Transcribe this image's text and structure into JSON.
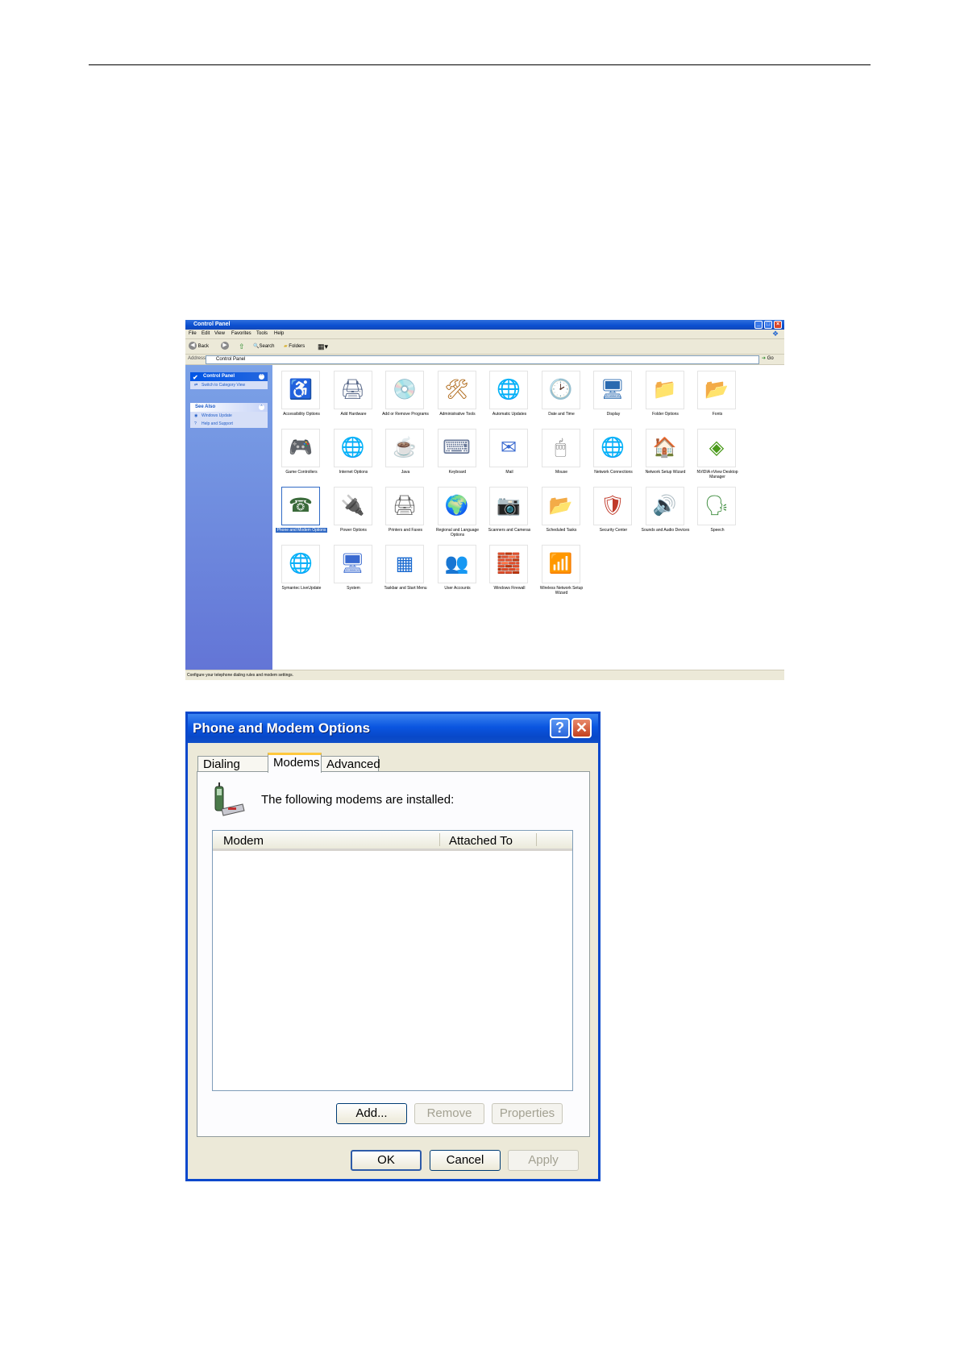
{
  "control_panel": {
    "title": "Control Panel",
    "menu": [
      "File",
      "Edit",
      "View",
      "Favorites",
      "Tools",
      "Help"
    ],
    "toolbar": {
      "back": "Back",
      "search": "Search",
      "folders": "Folders"
    },
    "address_label": "Address",
    "address_value": "Control Panel",
    "go_label": "Go",
    "side_panel": {
      "title": "Control Panel",
      "switch_link": "Switch to Category View",
      "see_also_title": "See Also",
      "see_also": [
        "Windows Update",
        "Help and Support"
      ]
    },
    "items": [
      {
        "label": "Accessibility Options",
        "icon": "accessibility-icon",
        "glyph": "♿",
        "color": "#2a9a2a"
      },
      {
        "label": "Add Hardware",
        "icon": "add-hardware-icon",
        "glyph": "🖨",
        "color": "#5a6a8a"
      },
      {
        "label": "Add or Remove Programs",
        "icon": "add-remove-programs-icon",
        "glyph": "💿",
        "color": "#3a6ad0"
      },
      {
        "label": "Administrative Tools",
        "icon": "administrative-tools-icon",
        "glyph": "🛠",
        "color": "#b06a1a"
      },
      {
        "label": "Automatic Updates",
        "icon": "automatic-updates-icon",
        "glyph": "🌐",
        "color": "#1a6ad0"
      },
      {
        "label": "Date and Time",
        "icon": "date-time-icon",
        "glyph": "🕑",
        "color": "#2a5ab0"
      },
      {
        "label": "Display",
        "icon": "display-icon",
        "glyph": "🖥",
        "color": "#2a6ab0"
      },
      {
        "label": "Folder Options",
        "icon": "folder-options-icon",
        "glyph": "📁",
        "color": "#d8b030"
      },
      {
        "label": "Fonts",
        "icon": "fonts-icon",
        "glyph": "📂",
        "color": "#d8b030"
      },
      {
        "label": "Game Controllers",
        "icon": "game-controllers-icon",
        "glyph": "🎮",
        "color": "#6a6ab0"
      },
      {
        "label": "Internet Options",
        "icon": "internet-options-icon",
        "glyph": "🌐",
        "color": "#1a6ad0"
      },
      {
        "label": "Java",
        "icon": "java-icon",
        "glyph": "☕",
        "color": "#c04a1a"
      },
      {
        "label": "Keyboard",
        "icon": "keyboard-icon",
        "glyph": "⌨",
        "color": "#6a7a9a"
      },
      {
        "label": "Mail",
        "icon": "mail-icon",
        "glyph": "✉",
        "color": "#3a6ad0"
      },
      {
        "label": "Mouse",
        "icon": "mouse-icon",
        "glyph": "🖱",
        "color": "#7a7a7a"
      },
      {
        "label": "Network Connections",
        "icon": "network-connections-icon",
        "glyph": "🌐",
        "color": "#1a8a3a"
      },
      {
        "label": "Network Setup Wizard",
        "icon": "network-setup-wizard-icon",
        "glyph": "🏠",
        "color": "#c04a1a"
      },
      {
        "label": "NVIDIA nView Desktop Manager",
        "icon": "nvidia-icon",
        "glyph": "◈",
        "color": "#4a9a1a"
      },
      {
        "label": "Phone and Modem Options",
        "icon": "phone-modem-icon",
        "glyph": "☎",
        "color": "#3a6a3a"
      },
      {
        "label": "Power Options",
        "icon": "power-options-icon",
        "glyph": "🔌",
        "color": "#6a6a6a"
      },
      {
        "label": "Printers and Faxes",
        "icon": "printers-faxes-icon",
        "glyph": "🖨",
        "color": "#6a6a6a"
      },
      {
        "label": "Regional and Language Options",
        "icon": "regional-language-icon",
        "glyph": "🌍",
        "color": "#1a6ad0"
      },
      {
        "label": "Scanners and Cameras",
        "icon": "scanners-cameras-icon",
        "glyph": "📷",
        "color": "#6a6a6a"
      },
      {
        "label": "Scheduled Tasks",
        "icon": "scheduled-tasks-icon",
        "glyph": "📂",
        "color": "#d8b030"
      },
      {
        "label": "Security Center",
        "icon": "security-center-icon",
        "glyph": "🛡",
        "color": "#c03a2a"
      },
      {
        "label": "Sounds and Audio Devices",
        "icon": "sounds-audio-icon",
        "glyph": "🔊",
        "color": "#6a6a6a"
      },
      {
        "label": "Speech",
        "icon": "speech-icon",
        "glyph": "🗣",
        "color": "#3a8a3a"
      },
      {
        "label": "Symantec LiveUpdate",
        "icon": "symantec-liveupdate-icon",
        "glyph": "🌐",
        "color": "#d8b030"
      },
      {
        "label": "System",
        "icon": "system-icon",
        "glyph": "🖥",
        "color": "#3a6ad0"
      },
      {
        "label": "Taskbar and Start Menu",
        "icon": "taskbar-start-menu-icon",
        "glyph": "▦",
        "color": "#1a6ad0"
      },
      {
        "label": "User Accounts",
        "icon": "user-accounts-icon",
        "glyph": "👥",
        "color": "#3a8a3a"
      },
      {
        "label": "Windows Firewall",
        "icon": "windows-firewall-icon",
        "glyph": "🧱",
        "color": "#c04a1a"
      },
      {
        "label": "Wireless Network Setup Wizard",
        "icon": "wireless-setup-icon",
        "glyph": "📶",
        "color": "#6a6a6a"
      }
    ],
    "selected_item": "Phone and Modem Options",
    "status_text": "Configure your telephone dialing rules and modem settings."
  },
  "dialog": {
    "title": "Phone and Modem Options",
    "tabs": [
      "Dialing Rules",
      "Modems",
      "Advanced"
    ],
    "active_tab": "Modems",
    "description": "The following modems are  installed:",
    "columns": [
      "Modem",
      "Attached To"
    ],
    "rows": [],
    "buttons": {
      "add": "Add...",
      "remove": "Remove",
      "properties": "Properties",
      "ok": "OK",
      "cancel": "Cancel",
      "apply": "Apply"
    },
    "help_glyph": "?",
    "close_glyph": "✕"
  }
}
